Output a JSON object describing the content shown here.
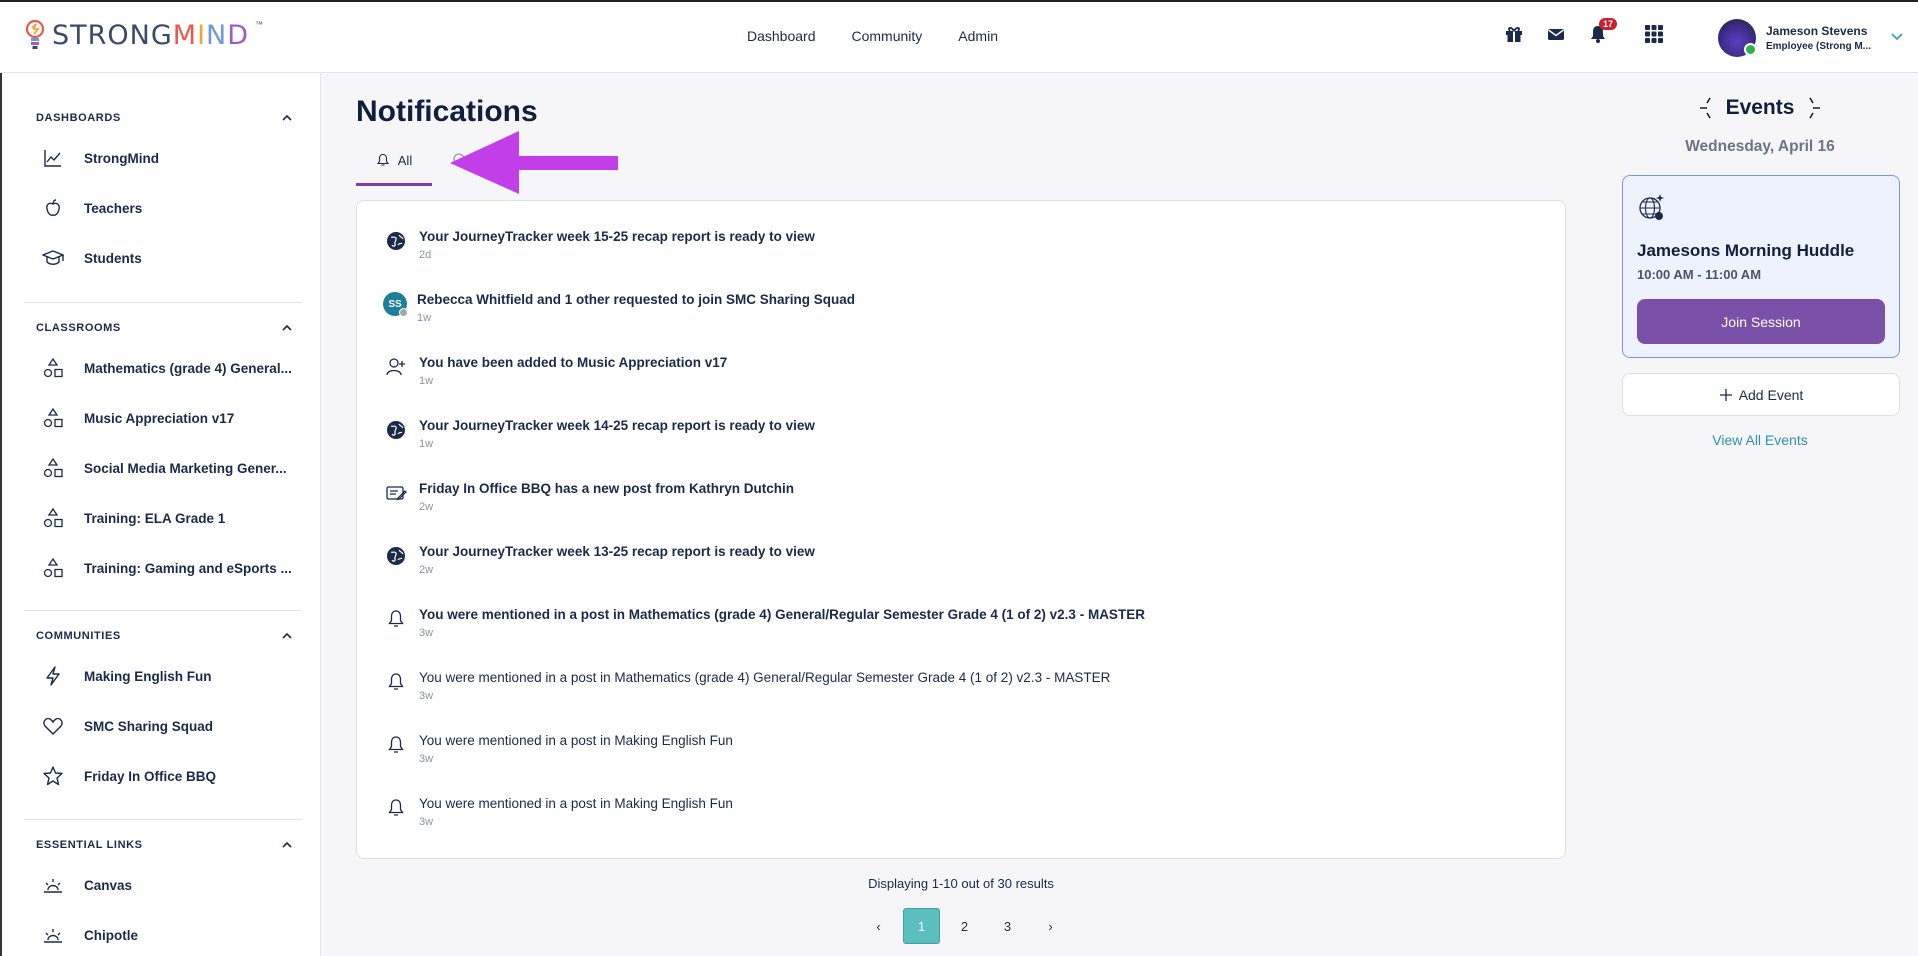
{
  "header": {
    "logo_text": "STRONGMIND",
    "logo_tm": "™",
    "nav": [
      "Dashboard",
      "Community",
      "Admin"
    ],
    "notification_count": "17",
    "user_name": "Jameson Stevens",
    "user_role": "Employee (Strong M..."
  },
  "sidebar": {
    "dashboards": {
      "title": "DASHBOARDS",
      "items": [
        "StrongMind",
        "Teachers",
        "Students"
      ]
    },
    "classrooms": {
      "title": "CLASSROOMS",
      "items": [
        "Mathematics (grade 4) General...",
        "Music Appreciation v17",
        "Social Media Marketing Gener...",
        "Training: ELA Grade 1",
        "Training: Gaming and eSports ..."
      ]
    },
    "communities": {
      "title": "COMMUNITIES",
      "items": [
        "Making English Fun",
        "SMC Sharing Squad",
        "Friday In Office BBQ"
      ]
    },
    "essential_links": {
      "title": "ESSENTIAL LINKS",
      "items": [
        "Canvas",
        "Chipotle"
      ]
    }
  },
  "main": {
    "title": "Notifications",
    "tab_all": "All",
    "tab_other": "​",
    "notifications": [
      {
        "text": "Your JourneyTracker week 15-25 recap report is ready to view",
        "time": "2d",
        "icon": "globe-icon",
        "unread": true
      },
      {
        "text": "Rebecca Whitfield and 1 other requested to join SMC Sharing Squad",
        "time": "1w",
        "icon": "avatar",
        "avatar_initials": "SS",
        "unread": true
      },
      {
        "text": "You have been added to Music Appreciation v17",
        "time": "1w",
        "icon": "user-plus-icon",
        "unread": true
      },
      {
        "text": "Your JourneyTracker week 14-25 recap report is ready to view",
        "time": "1w",
        "icon": "globe-icon",
        "unread": true
      },
      {
        "text": "Friday In Office BBQ has a new post from Kathryn Dutchin",
        "time": "2w",
        "icon": "post-icon",
        "unread": true
      },
      {
        "text": "Your JourneyTracker week 13-25 recap report is ready to view",
        "time": "2w",
        "icon": "globe-icon",
        "unread": true
      },
      {
        "text": "You were mentioned in a post in Mathematics (grade 4) General/Regular Semester Grade 4 (1 of 2) v2.3 - MASTER",
        "time": "3w",
        "icon": "bell-icon",
        "unread": true
      },
      {
        "text": "You were mentioned in a post in Mathematics (grade 4) General/Regular Semester Grade 4 (1 of 2) v2.3 - MASTER",
        "time": "3w",
        "icon": "bell-icon",
        "unread": false
      },
      {
        "text": "You were mentioned in a post in Making English Fun",
        "time": "3w",
        "icon": "bell-icon",
        "unread": false
      },
      {
        "text": "You were mentioned in a post in Making English Fun",
        "time": "3w",
        "icon": "bell-icon",
        "unread": false
      }
    ],
    "results_text": "Displaying 1-10 out of 30 results",
    "pages": [
      "1",
      "2",
      "3"
    ],
    "prev": "‹",
    "next": "›"
  },
  "events": {
    "title": "Events",
    "date": "Wednesday, April 16",
    "card_title": "Jamesons Morning Huddle",
    "card_time": "10:00 AM - 11:00 AM",
    "join_label": "Join Session",
    "add_label": "Add Event",
    "view_all": "View All Events"
  },
  "colors": {
    "accent_purple": "#7a4fa8",
    "annotation_arrow": "#c23ee8",
    "page_active": "#5bbfbf",
    "link": "#2e8fb8"
  }
}
